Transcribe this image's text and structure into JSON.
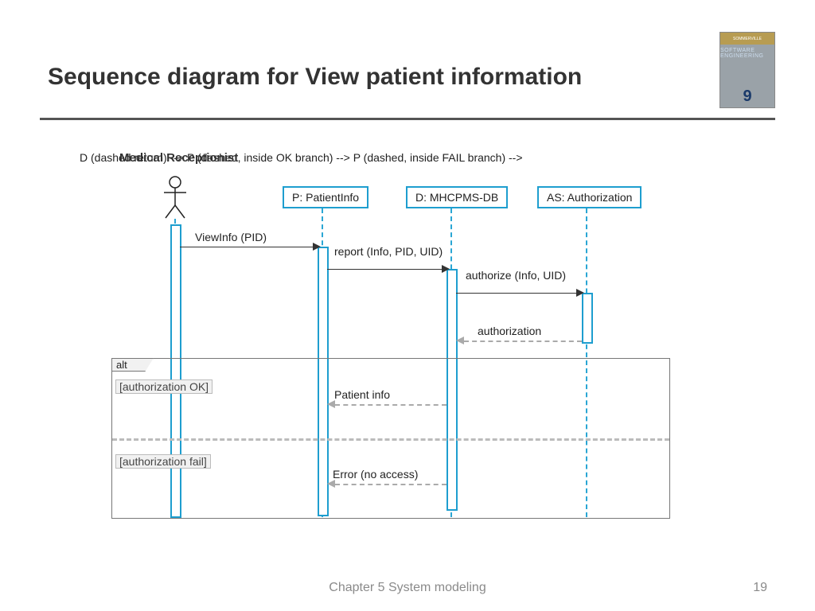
{
  "slide": {
    "title": "Sequence diagram for View patient information",
    "footer": "Chapter 5 System modeling",
    "page_number": "19",
    "book": {
      "series": "SOMMERVILLE",
      "title": "SOFTWARE ENGINEERING",
      "edition_digit": "9"
    }
  },
  "diagram": {
    "actor_label": "Medical Receptionist",
    "lifelines": {
      "patientinfo": "P: PatientInfo",
      "mhcpms": "D: MHCPMS-DB",
      "auth": "AS: Authorization"
    },
    "messages": {
      "viewinfo": "ViewInfo (PID)",
      "report": "report (Info, PID, UID)",
      "authorize": "authorize (Info, UID)",
      "authorization": "authorization",
      "patient_info": "Patient info",
      "error": "Error (no access)"
    },
    "fragment": {
      "tag": "alt",
      "guard_ok": "[authorization OK]",
      "guard_fail": "[authorization fail]"
    }
  }
}
